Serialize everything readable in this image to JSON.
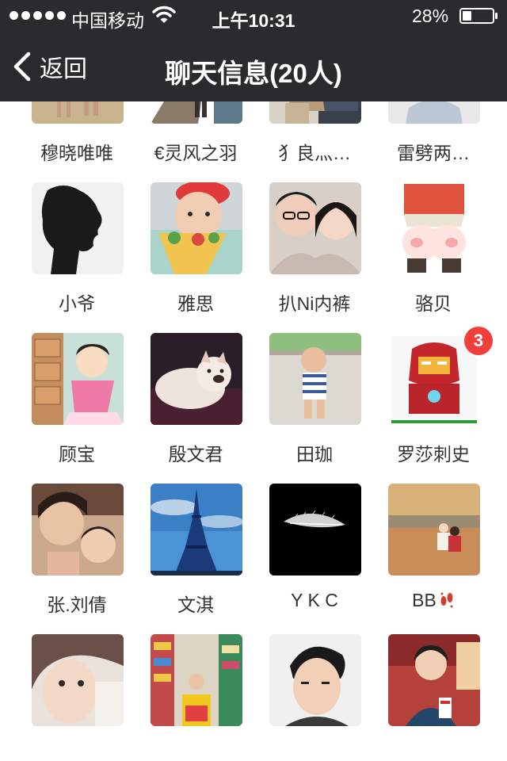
{
  "status_bar": {
    "carrier": "中国移动",
    "time": "上午10:31",
    "battery": "28%",
    "battery_level": 0.28
  },
  "nav_bar": {
    "back_label": "返回",
    "title": "聊天信息(20人)"
  },
  "members": [
    {
      "name": "穆晓唯唯",
      "avatar": "beach-couple"
    },
    {
      "name": "€灵风之羽",
      "avatar": "pier"
    },
    {
      "name": "犭良灬…",
      "avatar": "room"
    },
    {
      "name": "雷劈两…",
      "avatar": "girl"
    },
    {
      "name": "小爷",
      "avatar": "silhouette"
    },
    {
      "name": "雅思",
      "avatar": "baby-red-cap"
    },
    {
      "name": "扒Ni内裤",
      "avatar": "couple-selfie"
    },
    {
      "name": "骆贝",
      "avatar": "cartoon-bottom"
    },
    {
      "name": "顾宝",
      "avatar": "cartoon-girl"
    },
    {
      "name": "殷文君",
      "avatar": "bulldog"
    },
    {
      "name": "田珈",
      "avatar": "toddler"
    },
    {
      "name": "罗莎刺史",
      "avatar": "iron-man",
      "badge": "3"
    },
    {
      "name": "张.刘倩",
      "avatar": "mother-child"
    },
    {
      "name": "文淇",
      "avatar": "eiffel"
    },
    {
      "name": "Y K C",
      "avatar": "feather"
    },
    {
      "name": "BB",
      "avatar": "sunset-beach",
      "trailing_icon": "footprints-icon"
    },
    {
      "name": "",
      "avatar": "woman-closeup"
    },
    {
      "name": "",
      "avatar": "supermarket"
    },
    {
      "name": "",
      "avatar": "man-portrait"
    },
    {
      "name": "",
      "avatar": "boy-restaurant"
    }
  ]
}
